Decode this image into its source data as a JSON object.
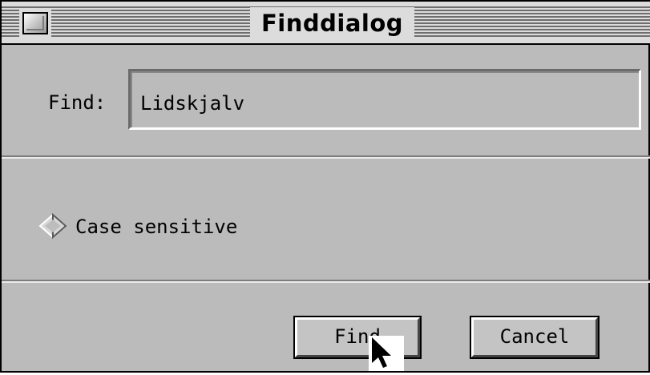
{
  "window": {
    "title": "Finddialog"
  },
  "find": {
    "label": "Find:",
    "value": "Lidskjalv"
  },
  "options": {
    "case_sensitive_label": "Case sensitive",
    "case_sensitive_checked": false
  },
  "buttons": {
    "find_label": "Find",
    "cancel_label": "Cancel"
  },
  "icons": {
    "close": "close-box-icon",
    "radio": "diamond-radio-icon",
    "cursor": "arrow-cursor-icon"
  }
}
